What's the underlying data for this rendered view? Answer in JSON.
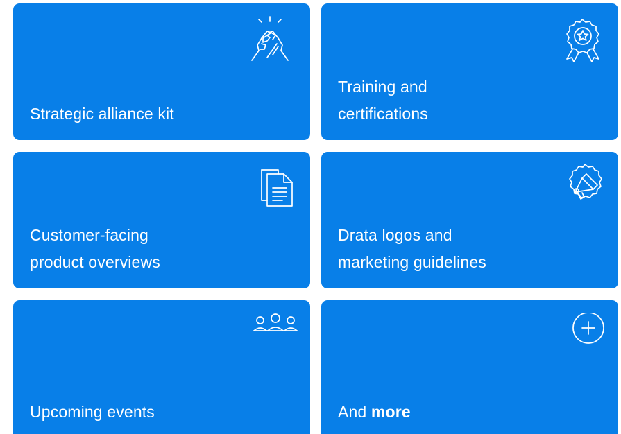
{
  "cards": [
    {
      "id": "strategic-alliance-kit",
      "lines": [
        "Strategic alliance kit"
      ],
      "icon": "handshake-icon"
    },
    {
      "id": "training-and-certifications",
      "lines": [
        "Training and",
        "certifications"
      ],
      "icon": "award-ribbon-icon"
    },
    {
      "id": "customer-facing-product-overviews",
      "lines": [
        "Customer-facing",
        "product overviews"
      ],
      "icon": "documents-icon"
    },
    {
      "id": "drata-logos-and-marketing-guidelines",
      "lines": [
        "Drata logos and",
        "marketing guidelines"
      ],
      "icon": "megaphone-badge-icon"
    },
    {
      "id": "upcoming-events",
      "lines": [
        "Upcoming events"
      ],
      "icon": "people-group-icon"
    },
    {
      "id": "and-more",
      "prefix": "And",
      "emphasis": "more",
      "icon": "plus-circle-icon"
    }
  ],
  "colors": {
    "card_background": "#087fe8",
    "text": "#ffffff",
    "page_background": "#ffffff"
  }
}
